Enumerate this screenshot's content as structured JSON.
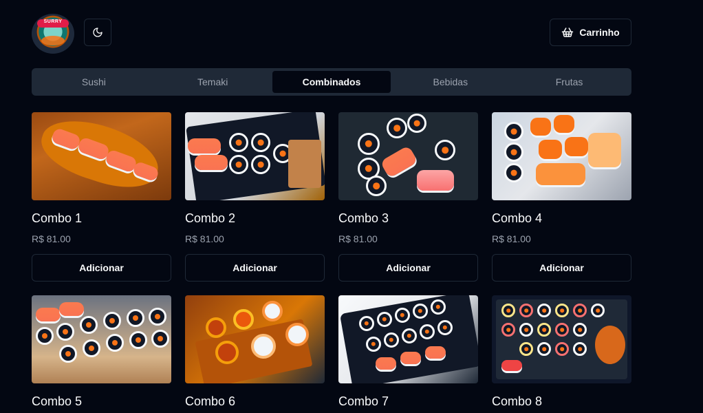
{
  "header": {
    "logo_text": "SURRY",
    "theme_icon": "moon-icon",
    "cart_icon": "basket-icon",
    "cart_label": "Carrinho"
  },
  "tabs": [
    {
      "label": "Sushi",
      "active": false
    },
    {
      "label": "Temaki",
      "active": false
    },
    {
      "label": "Combinados",
      "active": true
    },
    {
      "label": "Bebidas",
      "active": false
    },
    {
      "label": "Frutas",
      "active": false
    }
  ],
  "products": [
    {
      "name": "Combo 1",
      "price": "R$ 81.00",
      "button": "Adicionar"
    },
    {
      "name": "Combo 2",
      "price": "R$ 81.00",
      "button": "Adicionar"
    },
    {
      "name": "Combo 3",
      "price": "R$ 81.00",
      "button": "Adicionar"
    },
    {
      "name": "Combo 4",
      "price": "R$ 81.00",
      "button": "Adicionar"
    },
    {
      "name": "Combo 5"
    },
    {
      "name": "Combo 6"
    },
    {
      "name": "Combo 7"
    },
    {
      "name": "Combo 8"
    }
  ],
  "colors": {
    "background": "#030712",
    "tab_bar": "#1f2937",
    "muted_text": "#9ca3af",
    "border": "#1f2937"
  }
}
